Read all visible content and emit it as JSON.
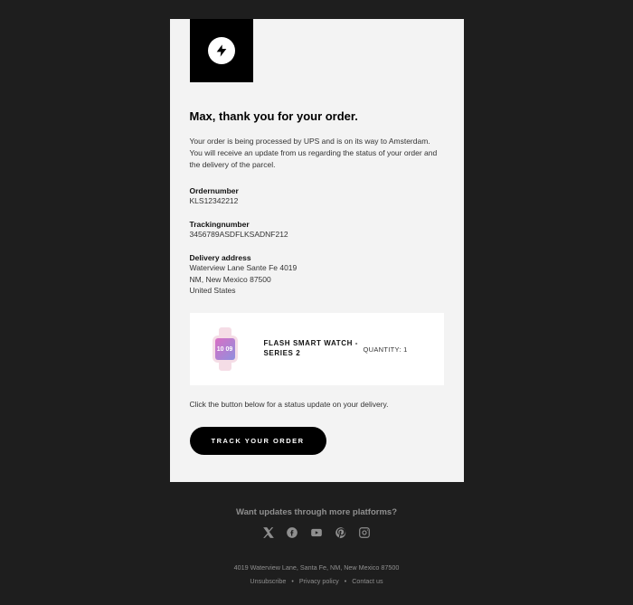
{
  "header": {
    "headline": "Max, thank you for your order.",
    "intro": "Your order is being processed by UPS and is on its way to Amsterdam. You will receive an update from us regarding the status of your order and the delivery of the parcel."
  },
  "order": {
    "ordernumber_label": "Ordernumber",
    "ordernumber": "KLS12342212",
    "trackingnumber_label": "Trackingnumber",
    "trackingnumber": "3456789ASDFLKSADNF212",
    "delivery_label": "Delivery address",
    "address_line1": "Waterview Lane Sante Fe 4019",
    "address_line2": "NM, New Mexico 87500",
    "address_line3": "United States"
  },
  "product": {
    "name": "FLASH SMART WATCH - SERIES 2",
    "quantity_label": "QUANTITY: 1",
    "watch_time": "10\n09"
  },
  "cta": {
    "note": "Click the button below for a status update on your delivery.",
    "button": "TRACK YOUR ORDER"
  },
  "footer": {
    "headline": "Want updates through more platforms?",
    "address": "4019 Waterview Lane, Santa Fe, NM, New Mexico 87500",
    "links": {
      "unsubscribe": "Unsubscribe",
      "privacy": "Privacy policy",
      "contact": "Contact us"
    }
  }
}
